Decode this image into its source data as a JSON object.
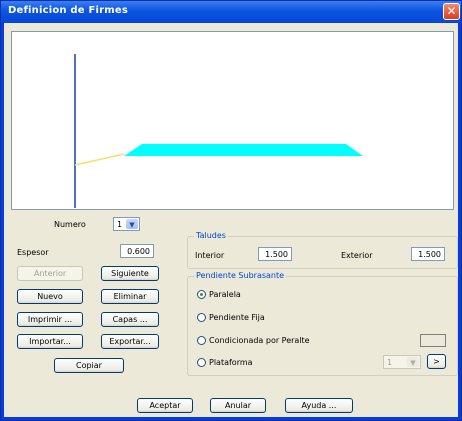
{
  "window": {
    "title": "Definicion de Firmes",
    "close_glyph": "✕"
  },
  "numero": {
    "label": "Numero",
    "value": "1"
  },
  "espesor": {
    "label": "Espesor",
    "value": "0.600"
  },
  "buttons": {
    "anterior": "Anterior",
    "siguiente": "Siguiente",
    "nuevo": "Nuevo",
    "eliminar": "Eliminar",
    "imprimir": "Imprimir ...",
    "capas": "Capas ...",
    "importar": "Importar...",
    "exportar": "Exportar...",
    "copiar": "Copiar"
  },
  "taludes": {
    "title": "Taludes",
    "interior_label": "Interior",
    "interior_value": "1.500",
    "exterior_label": "Exterior",
    "exterior_value": "1.500"
  },
  "pendiente": {
    "title": "Pendiente Subrasante",
    "options": [
      "Paralela",
      "Pendiente Fija",
      "Condicionada por Peralte",
      "Plataforma"
    ],
    "selected": "Paralela",
    "plataforma_combo": "1",
    "next_glyph": ">"
  },
  "footer": {
    "aceptar": "Aceptar",
    "anular": "Anular",
    "ayuda": "Ayuda ..."
  },
  "colors": {
    "fill": "#00ffff",
    "axis": "#1f3fae",
    "line": "#f5e16b"
  },
  "icons": {
    "close": "close-icon",
    "dropdown": "chevron-down-icon"
  }
}
